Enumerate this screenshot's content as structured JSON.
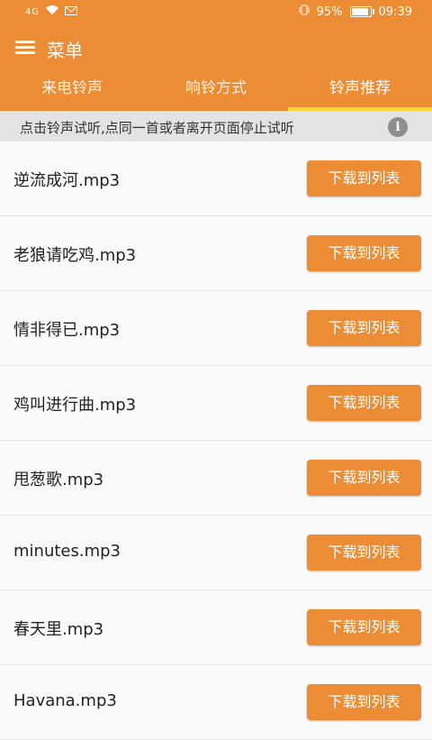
{
  "status": {
    "signal": "4G",
    "battery": "95%",
    "time": "09:39"
  },
  "header": {
    "title": "菜单"
  },
  "tabs": [
    {
      "label": "来电铃声"
    },
    {
      "label": "响铃方式"
    },
    {
      "label": "铃声推荐"
    }
  ],
  "active_tab": 2,
  "hint": "点击铃声试听,点同一首或者离开页面停止试听",
  "button_label": "下载到列表",
  "songs": [
    "逆流成河.mp3",
    "老狼请吃鸡.mp3",
    "情非得已.mp3",
    "鸡叫进行曲.mp3",
    "甩葱歌.mp3",
    "minutes.mp3",
    "春天里.mp3",
    "Havana.mp3"
  ],
  "colors": {
    "accent": "#ec8c34",
    "tab_indicator": "#f7d836"
  }
}
